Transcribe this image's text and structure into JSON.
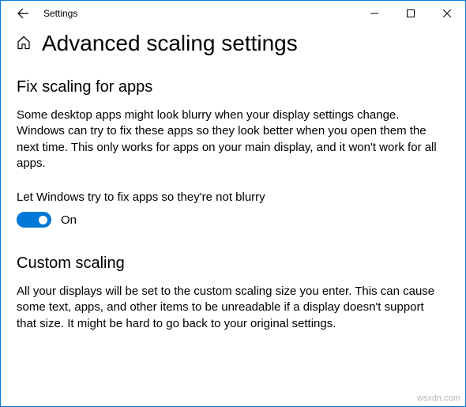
{
  "window": {
    "title": "Settings"
  },
  "page": {
    "title": "Advanced scaling settings"
  },
  "section1": {
    "title": "Fix scaling for apps",
    "description": "Some desktop apps might look blurry when your display settings change. Windows can try to fix these apps so they look better when you open them the next time. This only works for apps on your main display, and it won't work for all apps.",
    "toggle_label": "Let Windows try to fix apps so they're not blurry",
    "toggle_state": "On"
  },
  "section2": {
    "title": "Custom scaling",
    "description": "All your displays will be set to the custom scaling size you enter. This can cause some text, apps, and other items to be unreadable if a display doesn't support that size. It might be hard to go back to your original settings."
  },
  "watermark": "wsxdn.com"
}
